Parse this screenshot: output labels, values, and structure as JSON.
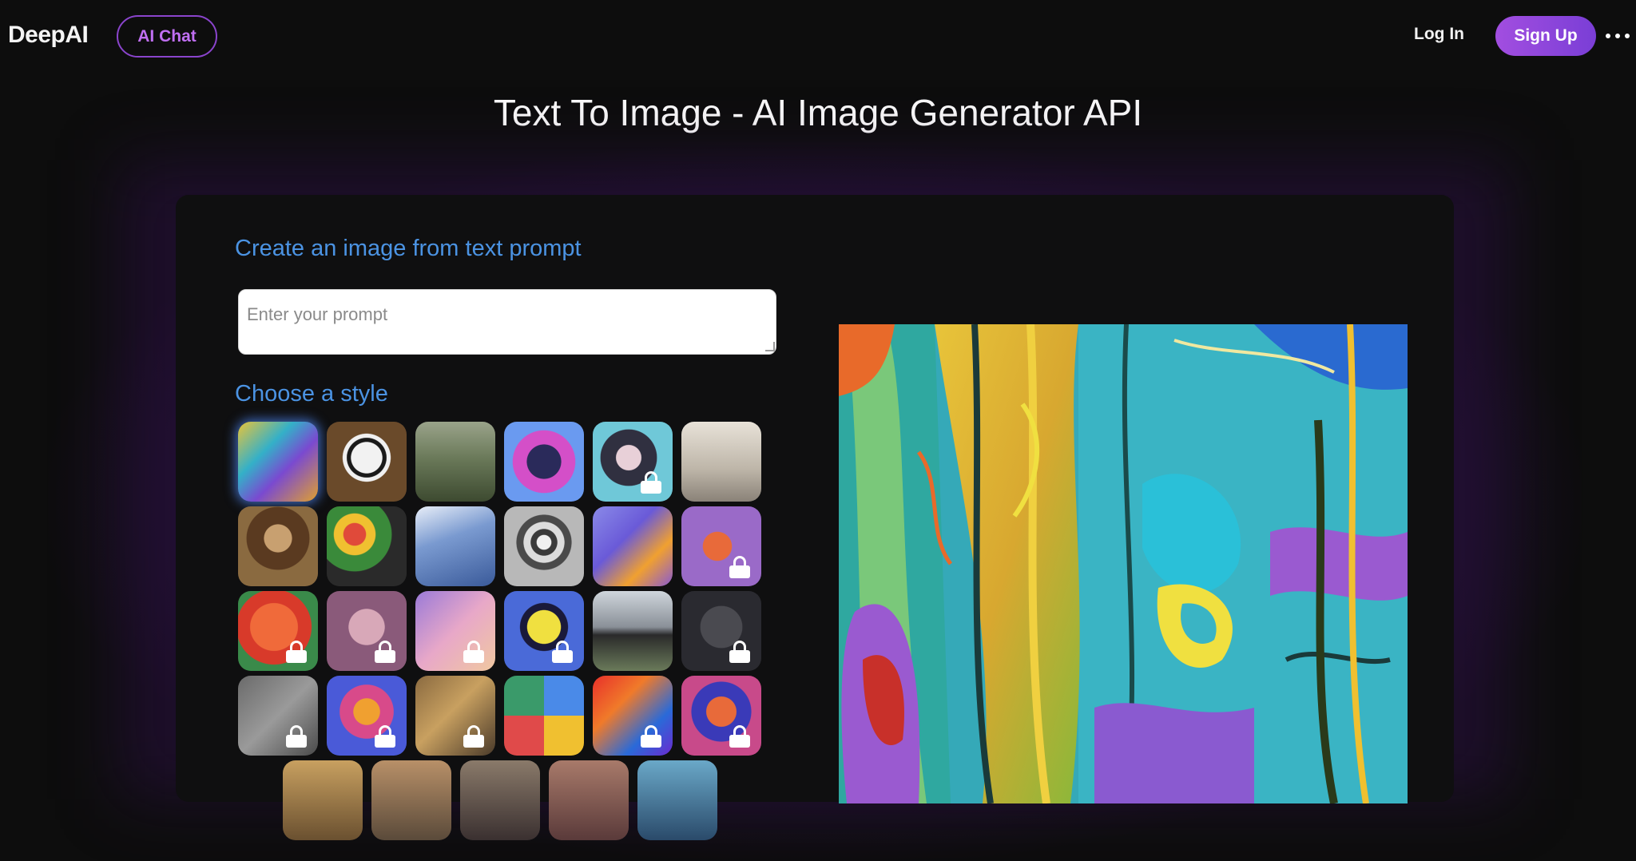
{
  "header": {
    "logo": "DeepAI",
    "ai_chat_label": "AI Chat",
    "login_label": "Log In",
    "signup_label": "Sign Up",
    "more_icon": "more-horizontal-icon"
  },
  "page_title": "Text To Image - AI Image Generator API",
  "generator": {
    "prompt_section_label": "Create an image from text prompt",
    "prompt_placeholder": "Enter your prompt",
    "prompt_value": "",
    "style_section_label": "Choose a style",
    "styles": [
      {
        "id": "style-1",
        "locked": false,
        "selected": true
      },
      {
        "id": "style-2",
        "locked": false
      },
      {
        "id": "style-3",
        "locked": false
      },
      {
        "id": "style-4",
        "locked": false
      },
      {
        "id": "style-5",
        "locked": true
      },
      {
        "id": "style-6",
        "locked": false
      },
      {
        "id": "style-7",
        "locked": false
      },
      {
        "id": "style-8",
        "locked": false
      },
      {
        "id": "style-9",
        "locked": false
      },
      {
        "id": "style-10",
        "locked": false
      },
      {
        "id": "style-11",
        "locked": false
      },
      {
        "id": "style-12",
        "locked": true
      },
      {
        "id": "style-13",
        "locked": true
      },
      {
        "id": "style-14",
        "locked": true
      },
      {
        "id": "style-15",
        "locked": true
      },
      {
        "id": "style-16",
        "locked": true
      },
      {
        "id": "style-17",
        "locked": false
      },
      {
        "id": "style-18",
        "locked": true
      },
      {
        "id": "style-19",
        "locked": true
      },
      {
        "id": "style-20",
        "locked": true
      },
      {
        "id": "style-21",
        "locked": true
      },
      {
        "id": "style-22",
        "locked": false
      },
      {
        "id": "style-23",
        "locked": true
      },
      {
        "id": "style-24",
        "locked": true
      }
    ]
  },
  "colors": {
    "accent_purple": "#a24ee0",
    "label_blue": "#4b93e3",
    "background": "#0d0d0d"
  }
}
